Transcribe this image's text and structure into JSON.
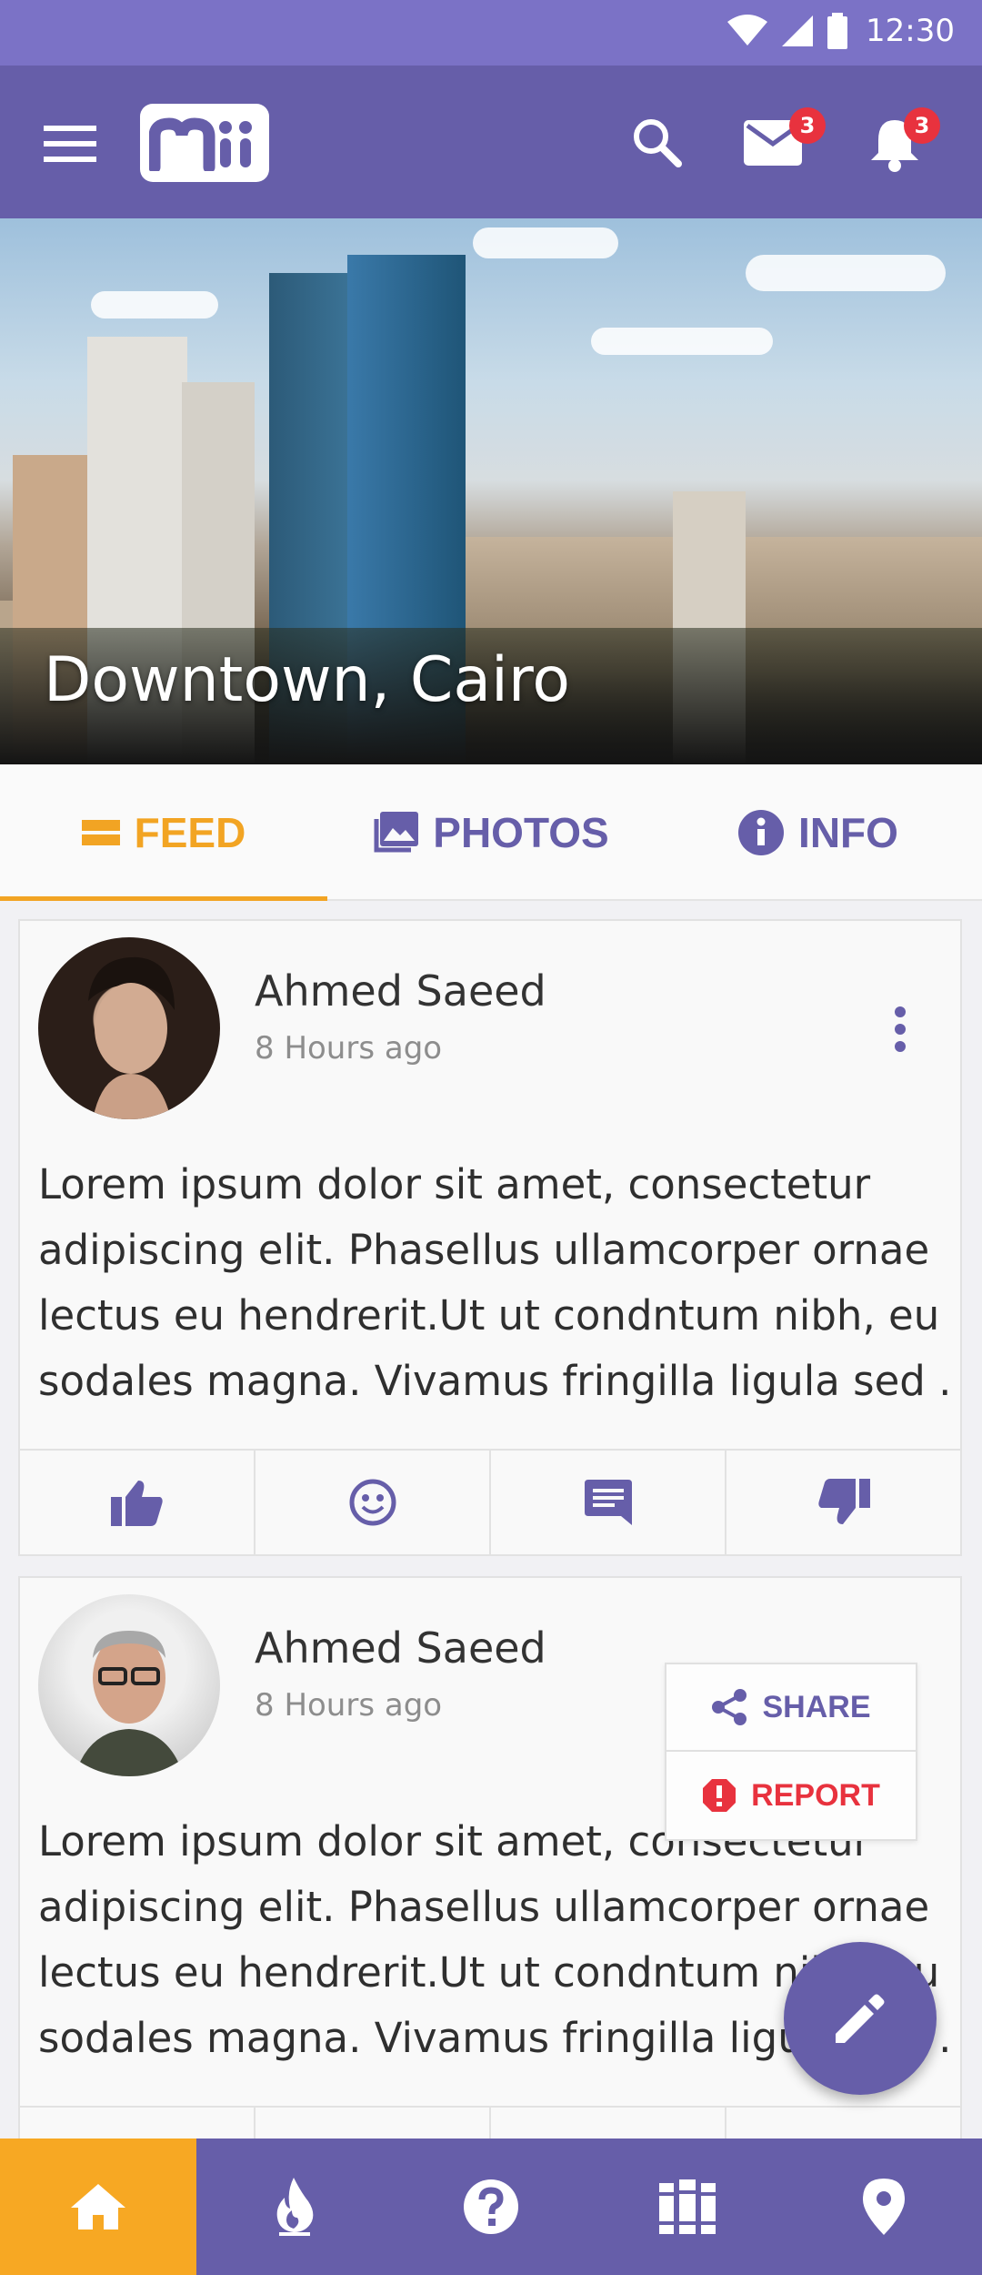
{
  "status_bar": {
    "time": "12:30"
  },
  "app_bar": {
    "logo_text": "Mii",
    "mail_badge": "3",
    "notification_badge": "3"
  },
  "hero": {
    "title": "Downtown, Cairo"
  },
  "tabs": [
    {
      "label": "FEED",
      "icon": "feed-icon",
      "active": true
    },
    {
      "label": "PHOTOS",
      "icon": "photo-icon",
      "active": false
    },
    {
      "label": "INFO",
      "icon": "info-icon",
      "active": false
    }
  ],
  "posts": [
    {
      "author": "Ahmed Saeed",
      "time": "8 Hours ago",
      "text": "Lorem ipsum dolor sit amet, consectetur adipiscing elit. Phasellus ullamcorper ornae lectus eu hendrerit.Ut ut condntum nibh, eu sodales magna. Vivamus fringilla ligula sed ."
    },
    {
      "author": "Ahmed Saeed",
      "time": "8 Hours ago",
      "text": "Lorem ipsum dolor sit amet, consectetur adipiscing elit. Phasellus ullamcorper ornae lectus eu hendrerit.Ut ut condntum nibh, eu sodales magna. Vivamus fringilla ligula sed ."
    }
  ],
  "post_actions": [
    "thumbs-up-icon",
    "smiley-icon",
    "comment-icon",
    "thumbs-down-icon"
  ],
  "popup_menu": {
    "share": "SHARE",
    "report": "REPORT"
  },
  "bottom_nav": [
    {
      "icon": "home-icon",
      "active": true
    },
    {
      "icon": "fire-icon",
      "active": false
    },
    {
      "icon": "help-icon",
      "active": false
    },
    {
      "icon": "library-icon",
      "active": false
    },
    {
      "icon": "location-pin-icon",
      "active": false
    }
  ],
  "colors": {
    "primary": "#665ea9",
    "status_bar": "#7b72c6",
    "accent": "#f2a423",
    "badge": "#e8323e"
  }
}
